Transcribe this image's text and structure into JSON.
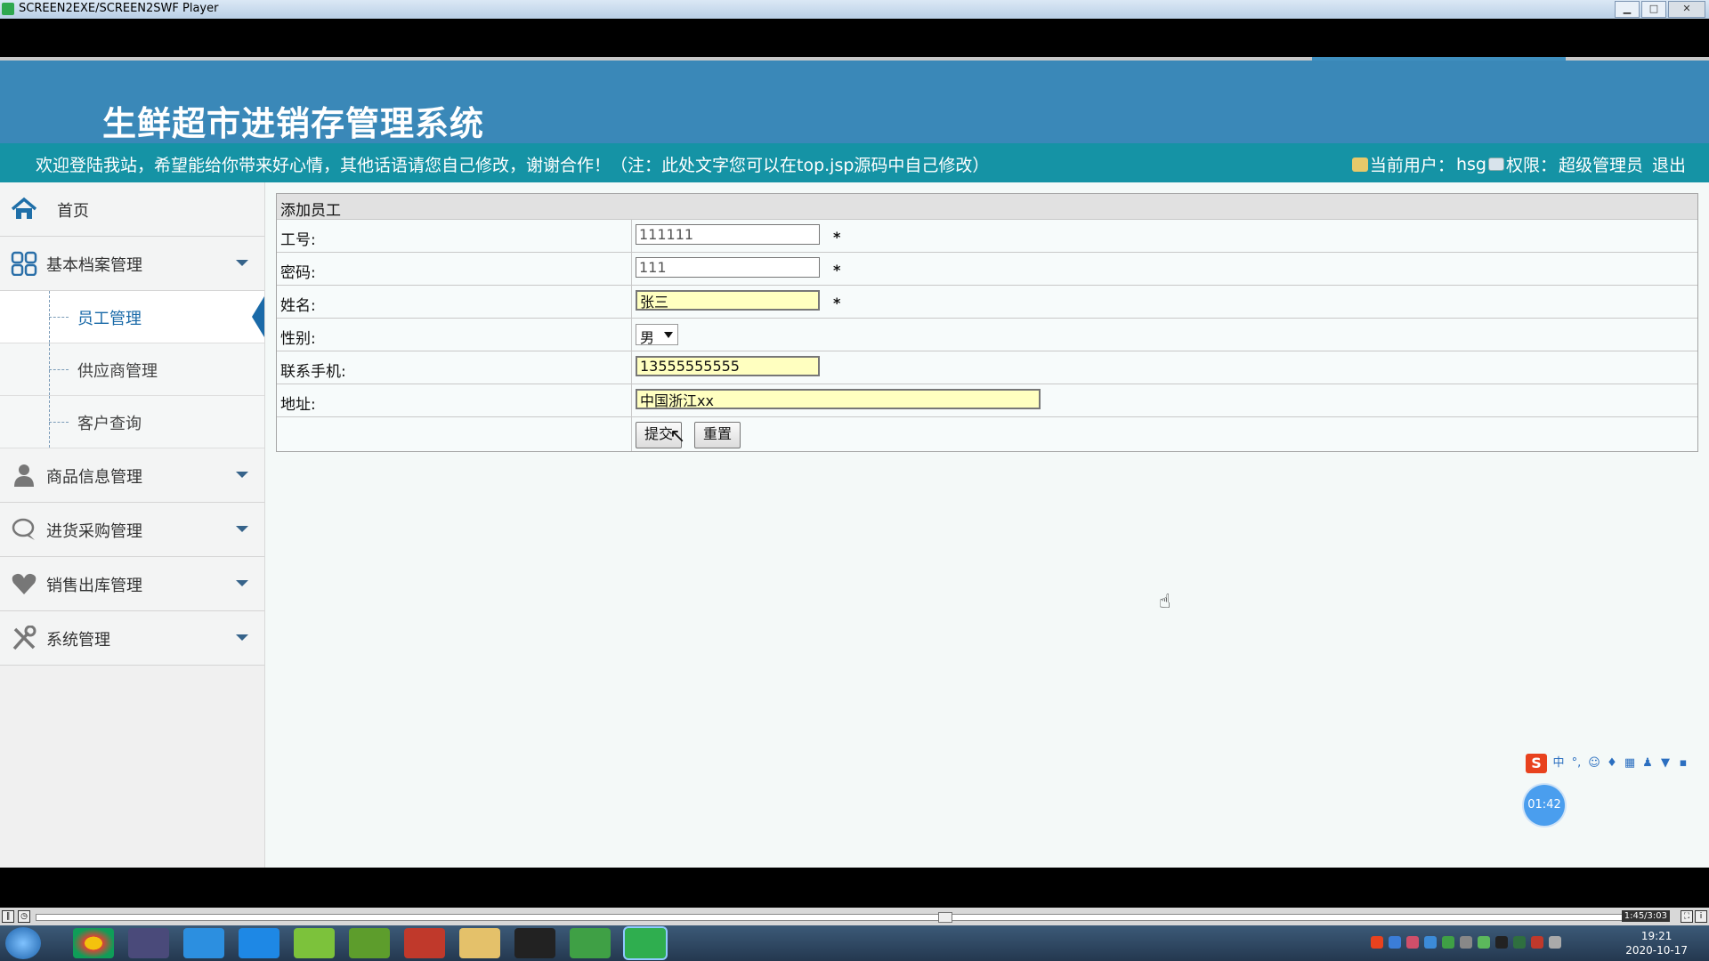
{
  "window": {
    "title": "SCREEN2EXE/SCREEN2SWF Player",
    "buttons": {
      "minimize": "▁",
      "maximize": "□",
      "close": "✕"
    }
  },
  "header": {
    "system_title": "生鲜超市进销存管理系统",
    "welcome_message": "欢迎登陆我站，希望能给你带来好心情，其他话语请您自己修改，谢谢合作！（注：此处文字您可以在top.jsp源码中自己修改）",
    "current_user_label": "当前用户：",
    "current_user": "hsg",
    "permission_label": "权限：",
    "permission": "超级管理员",
    "logout": "退出"
  },
  "sidebar": {
    "home": "首页",
    "groups": [
      {
        "label": "基本档案管理",
        "icon": "grid-icon"
      },
      {
        "label": "商品信息管理",
        "icon": "person-icon"
      },
      {
        "label": "进货采购管理",
        "icon": "chat-icon"
      },
      {
        "label": "销售出库管理",
        "icon": "heart-icon"
      },
      {
        "label": "系统管理",
        "icon": "tools-icon"
      }
    ],
    "sub_items": [
      "员工管理",
      "供应商管理",
      "客户查询"
    ]
  },
  "form": {
    "heading": "添加员工",
    "fields": {
      "emp_no": {
        "label": "工号:",
        "value": "111111"
      },
      "password": {
        "label": "密码:",
        "value": "111"
      },
      "name": {
        "label": "姓名:",
        "value": "张三"
      },
      "gender": {
        "label": "性别:",
        "value": "男"
      },
      "phone": {
        "label": "联系手机:",
        "value": "13555555555"
      },
      "address": {
        "label": "地址:",
        "value": "中国浙江xx"
      }
    },
    "required_mark": "*",
    "submit": "提交",
    "reset": "重置"
  },
  "widgets": {
    "ime_logo": "S",
    "ime_mode": "中",
    "timer": "01:42"
  },
  "player": {
    "time": "1:45/3:03"
  },
  "taskbar": {
    "time": "19:21",
    "date": "2020-10-17"
  },
  "colors": {
    "banner": "#3a88b8",
    "welcome_bar": "#1593a5",
    "accent": "#1a6aa8",
    "highlight_input": "#ffffc0"
  }
}
